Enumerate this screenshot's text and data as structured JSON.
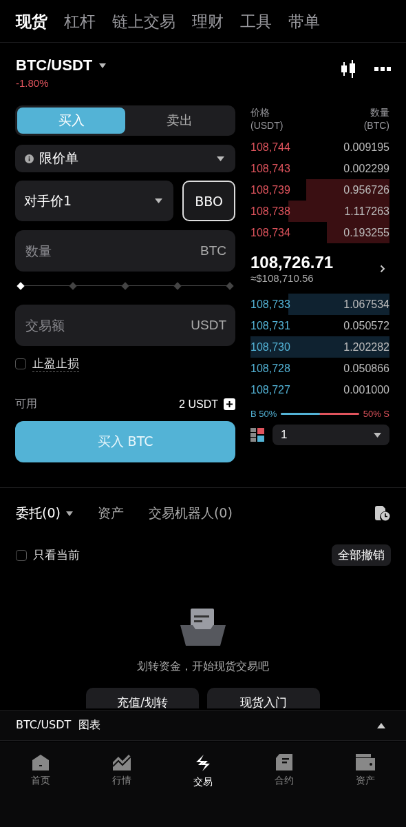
{
  "top_tabs": [
    {
      "label": "现货",
      "selected": true
    },
    {
      "label": "杠杆",
      "selected": false
    },
    {
      "label": "链上交易",
      "selected": false
    },
    {
      "label": "理财",
      "selected": false
    },
    {
      "label": "工具",
      "selected": false
    },
    {
      "label": "带单",
      "selected": false
    }
  ],
  "pair": {
    "symbol": "BTC/USDT",
    "change": "-1.80%"
  },
  "order_form": {
    "sides": [
      {
        "label": "买入",
        "selected": true
      },
      {
        "label": "卖出",
        "selected": false
      }
    ],
    "order_type": "限价单",
    "price_mode": "对手价1",
    "bbo_button": "BBO",
    "quantity": {
      "placeholder": "数量",
      "unit": "BTC"
    },
    "amount": {
      "placeholder": "交易额",
      "unit": "USDT"
    },
    "tp_sl": {
      "label": "止盈止损",
      "checked": false
    },
    "available": {
      "label": "可用",
      "value": "2 USDT"
    },
    "submit": "买入 BTC"
  },
  "order_book": {
    "price_label": "价格",
    "price_unit": "(USDT)",
    "amount_label": "数量",
    "amount_unit": "(BTC)",
    "asks": [
      {
        "price": "108,744",
        "amount": "0.009195"
      },
      {
        "price": "108,743",
        "amount": "0.002299"
      },
      {
        "price": "108,739",
        "amount": "0.956726"
      },
      {
        "price": "108,738",
        "amount": "1.117263"
      },
      {
        "price": "108,734",
        "amount": "0.193255"
      }
    ],
    "last_price": "108,726.71",
    "last_price_usd": "≈$108,710.56",
    "bids": [
      {
        "price": "108,733",
        "amount": "1.067534"
      },
      {
        "price": "108,731",
        "amount": "0.050572"
      },
      {
        "price": "108,730",
        "amount": "1.202282"
      },
      {
        "price": "108,728",
        "amount": "0.050866"
      },
      {
        "price": "108,727",
        "amount": "0.001000"
      }
    ],
    "ratio": {
      "buy_label": "B 50%",
      "sell_label": "50% S",
      "level": 0.5
    },
    "depth": "1"
  },
  "orders": {
    "tabs": [
      {
        "label": "委托(0)",
        "selected": true
      },
      {
        "label": "资产",
        "selected": false
      },
      {
        "label": "交易机器人(0)",
        "selected": false
      }
    ],
    "only_current": {
      "label": "只看当前",
      "checked": false
    },
    "cancel_all": "全部撤销",
    "empty_text": "划转资金，开始现货交易吧",
    "buttons": [
      "充值/划转",
      "现货入门"
    ]
  },
  "chart_bar": {
    "label": "BTC/USDT  图表"
  },
  "bottom_nav": [
    {
      "kind": "home",
      "label": "首页",
      "selected": false
    },
    {
      "kind": "market",
      "label": "行情",
      "selected": false
    },
    {
      "kind": "trade",
      "label": "交易",
      "selected": true
    },
    {
      "kind": "contract",
      "label": "合约",
      "selected": false
    },
    {
      "kind": "assets",
      "label": "资产",
      "selected": false
    }
  ]
}
